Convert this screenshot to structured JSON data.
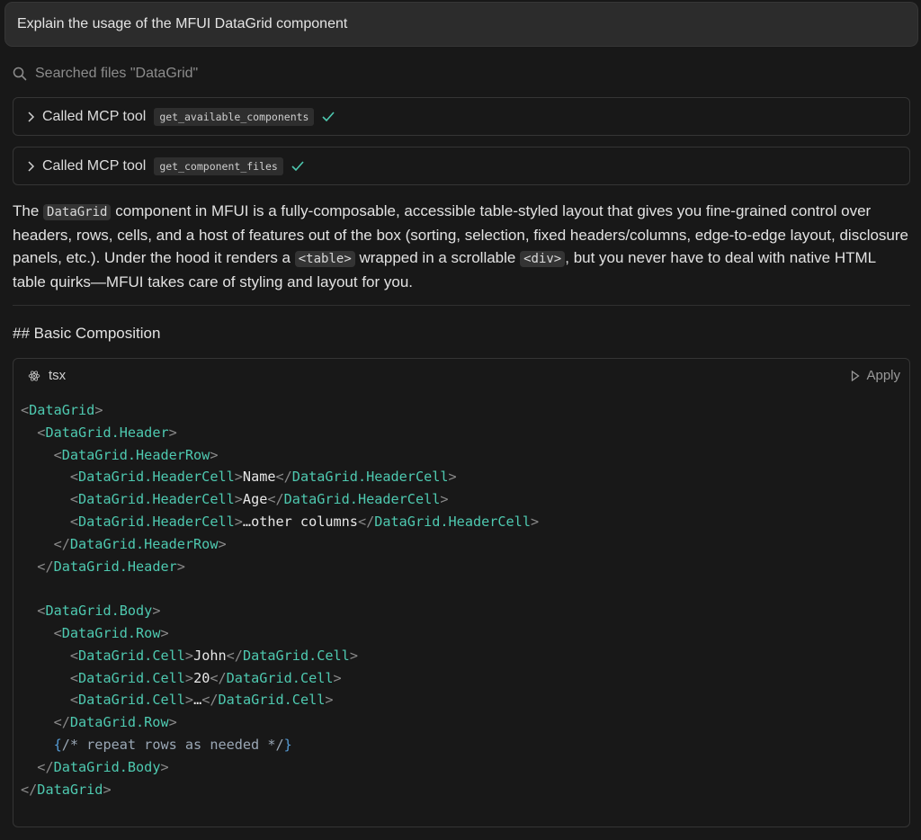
{
  "query": {
    "text": "Explain the usage of the MFUI DataGrid component"
  },
  "search": {
    "label": "Searched files \"DataGrid\""
  },
  "tool_calls": [
    {
      "label": "Called MCP tool",
      "tool": "get_available_components"
    },
    {
      "label": "Called MCP tool",
      "tool": "get_component_files"
    }
  ],
  "paragraph": {
    "p1": "The ",
    "c1": "DataGrid",
    "p2": " component in MFUI is a fully-composable, accessible table-styled layout that gives you fine-grained control over headers, rows, cells, and a host of features out of the box (sorting, selection, fixed headers/columns, edge-to-edge layout, disclosure panels, etc.). Under the hood it renders a ",
    "c2": "<table>",
    "p3": " wrapped in a scrollable ",
    "c3": "<div>",
    "p4": ", but you never have to deal with native HTML table quirks—MFUI takes care of styling and layout for you."
  },
  "heading": "## Basic Composition",
  "code_block": {
    "language": "tsx",
    "apply_label": "Apply",
    "lines": [
      [
        [
          "br",
          "<"
        ],
        [
          "tag",
          "DataGrid"
        ],
        [
          "br",
          ">"
        ]
      ],
      [
        [
          "tx",
          "  "
        ],
        [
          "br",
          "<"
        ],
        [
          "tag",
          "DataGrid.Header"
        ],
        [
          "br",
          ">"
        ]
      ],
      [
        [
          "tx",
          "    "
        ],
        [
          "br",
          "<"
        ],
        [
          "tag",
          "DataGrid.HeaderRow"
        ],
        [
          "br",
          ">"
        ]
      ],
      [
        [
          "tx",
          "      "
        ],
        [
          "br",
          "<"
        ],
        [
          "tag",
          "DataGrid.HeaderCell"
        ],
        [
          "br",
          ">"
        ],
        [
          "tx",
          "Name"
        ],
        [
          "br",
          "</"
        ],
        [
          "tag",
          "DataGrid.HeaderCell"
        ],
        [
          "br",
          ">"
        ]
      ],
      [
        [
          "tx",
          "      "
        ],
        [
          "br",
          "<"
        ],
        [
          "tag",
          "DataGrid.HeaderCell"
        ],
        [
          "br",
          ">"
        ],
        [
          "tx",
          "Age"
        ],
        [
          "br",
          "</"
        ],
        [
          "tag",
          "DataGrid.HeaderCell"
        ],
        [
          "br",
          ">"
        ]
      ],
      [
        [
          "tx",
          "      "
        ],
        [
          "br",
          "<"
        ],
        [
          "tag",
          "DataGrid.HeaderCell"
        ],
        [
          "br",
          ">"
        ],
        [
          "tx",
          "…other columns"
        ],
        [
          "br",
          "</"
        ],
        [
          "tag",
          "DataGrid.HeaderCell"
        ],
        [
          "br",
          ">"
        ]
      ],
      [
        [
          "tx",
          "    "
        ],
        [
          "br",
          "</"
        ],
        [
          "tag",
          "DataGrid.HeaderRow"
        ],
        [
          "br",
          ">"
        ]
      ],
      [
        [
          "tx",
          "  "
        ],
        [
          "br",
          "</"
        ],
        [
          "tag",
          "DataGrid.Header"
        ],
        [
          "br",
          ">"
        ]
      ],
      [
        [
          "tx",
          ""
        ]
      ],
      [
        [
          "tx",
          "  "
        ],
        [
          "br",
          "<"
        ],
        [
          "tag",
          "DataGrid.Body"
        ],
        [
          "br",
          ">"
        ]
      ],
      [
        [
          "tx",
          "    "
        ],
        [
          "br",
          "<"
        ],
        [
          "tag",
          "DataGrid.Row"
        ],
        [
          "br",
          ">"
        ]
      ],
      [
        [
          "tx",
          "      "
        ],
        [
          "br",
          "<"
        ],
        [
          "tag",
          "DataGrid.Cell"
        ],
        [
          "br",
          ">"
        ],
        [
          "tx",
          "John"
        ],
        [
          "br",
          "</"
        ],
        [
          "tag",
          "DataGrid.Cell"
        ],
        [
          "br",
          ">"
        ]
      ],
      [
        [
          "tx",
          "      "
        ],
        [
          "br",
          "<"
        ],
        [
          "tag",
          "DataGrid.Cell"
        ],
        [
          "br",
          ">"
        ],
        [
          "tx",
          "20"
        ],
        [
          "br",
          "</"
        ],
        [
          "tag",
          "DataGrid.Cell"
        ],
        [
          "br",
          ">"
        ]
      ],
      [
        [
          "tx",
          "      "
        ],
        [
          "br",
          "<"
        ],
        [
          "tag",
          "DataGrid.Cell"
        ],
        [
          "br",
          ">"
        ],
        [
          "tx",
          "…"
        ],
        [
          "br",
          "</"
        ],
        [
          "tag",
          "DataGrid.Cell"
        ],
        [
          "br",
          ">"
        ]
      ],
      [
        [
          "tx",
          "    "
        ],
        [
          "br",
          "</"
        ],
        [
          "tag",
          "DataGrid.Row"
        ],
        [
          "br",
          ">"
        ]
      ],
      [
        [
          "tx",
          "    "
        ],
        [
          "cb",
          "{"
        ],
        [
          "cm",
          "/* repeat rows as needed */"
        ],
        [
          "cb",
          "}"
        ]
      ],
      [
        [
          "tx",
          "  "
        ],
        [
          "br",
          "</"
        ],
        [
          "tag",
          "DataGrid.Body"
        ],
        [
          "br",
          ">"
        ]
      ],
      [
        [
          "br",
          "</"
        ],
        [
          "tag",
          "DataGrid"
        ],
        [
          "br",
          ">"
        ]
      ]
    ]
  },
  "colors": {
    "background": "#181818",
    "tag": "#4ec9b0",
    "check": "#4ec9b0"
  }
}
